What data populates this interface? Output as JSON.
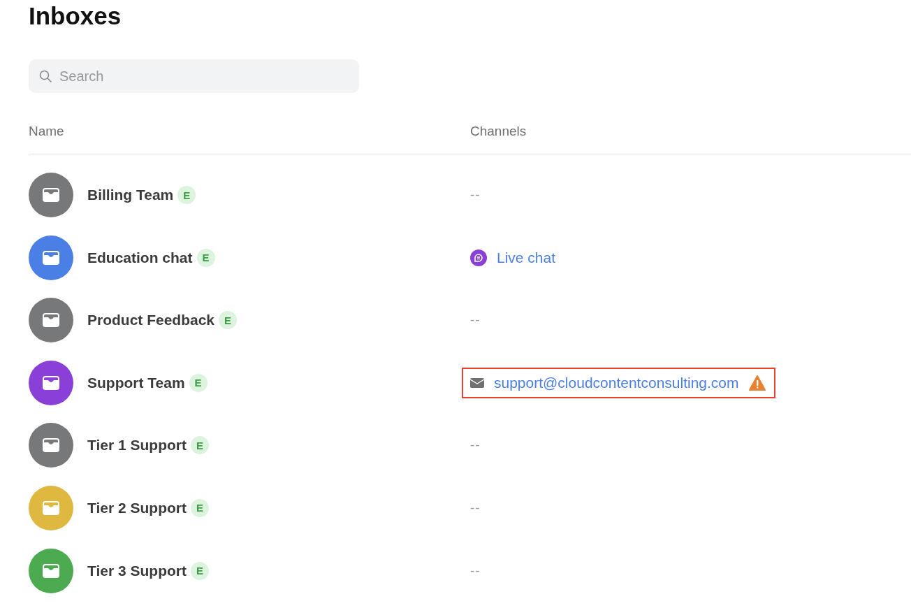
{
  "title": "Inboxes",
  "search": {
    "placeholder": "Search"
  },
  "table": {
    "columns": [
      "Name",
      "Channels"
    ],
    "rows": [
      {
        "name": {
          "text": "Billing Team",
          "badge": "E",
          "color": "#77787a"
        },
        "channels": {
          "kind": "none",
          "text": "--",
          "warning": false,
          "highlighted": false
        }
      },
      {
        "name": {
          "text": "Education chat",
          "badge": "E",
          "color": "#4a7fe5"
        },
        "channels": {
          "kind": "chat",
          "text": "Live chat",
          "warning": false,
          "highlighted": false
        }
      },
      {
        "name": {
          "text": "Product Feedback",
          "badge": "E",
          "color": "#77787a"
        },
        "channels": {
          "kind": "none",
          "text": "--",
          "warning": false,
          "highlighted": false
        }
      },
      {
        "name": {
          "text": "Support Team",
          "badge": "E",
          "color": "#8a3fd9"
        },
        "channels": {
          "kind": "email",
          "text": "support@cloudcontentconsulting.com",
          "warning": true,
          "highlighted": true
        }
      },
      {
        "name": {
          "text": "Tier 1 Support",
          "badge": "E",
          "color": "#77787a"
        },
        "channels": {
          "kind": "none",
          "text": "--",
          "warning": false,
          "highlighted": false
        }
      },
      {
        "name": {
          "text": "Tier 2 Support",
          "badge": "E",
          "color": "#dfb83f"
        },
        "channels": {
          "kind": "none",
          "text": "--",
          "warning": false,
          "highlighted": false
        }
      },
      {
        "name": {
          "text": "Tier 3 Support",
          "badge": "E",
          "color": "#4caa50"
        },
        "channels": {
          "kind": "none",
          "text": "--",
          "warning": false,
          "highlighted": false
        }
      }
    ]
  }
}
